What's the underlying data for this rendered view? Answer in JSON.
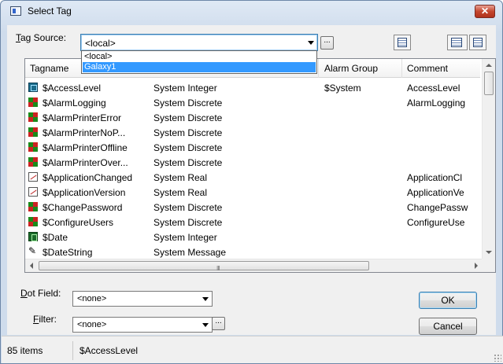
{
  "window": {
    "title": "Select Tag",
    "close_label": "✕"
  },
  "tag_source": {
    "label_accel": "T",
    "label_rest": "ag Source:",
    "value": "<local>",
    "browse_label": "...",
    "options": [
      "<local>",
      "Galaxy1"
    ],
    "highlighted_option": "Galaxy1"
  },
  "grid": {
    "columns": [
      "Tagname",
      "Alarm Group",
      "Comment"
    ],
    "rows": [
      {
        "icon": "integer-tag-icon",
        "tagname": "$AccessLevel",
        "type": "System Integer",
        "alarm_group": "$System",
        "comment": "AccessLevel"
      },
      {
        "icon": "discrete-tag-icon",
        "tagname": "$AlarmLogging",
        "type": "System Discrete",
        "alarm_group": "",
        "comment": "AlarmLogging"
      },
      {
        "icon": "discrete-tag-icon",
        "tagname": "$AlarmPrinterError",
        "type": "System Discrete",
        "alarm_group": "",
        "comment": ""
      },
      {
        "icon": "discrete-tag-icon",
        "tagname": "$AlarmPrinterNoP...",
        "type": "System Discrete",
        "alarm_group": "",
        "comment": ""
      },
      {
        "icon": "discrete-tag-icon",
        "tagname": "$AlarmPrinterOffline",
        "type": "System Discrete",
        "alarm_group": "",
        "comment": ""
      },
      {
        "icon": "discrete-tag-icon",
        "tagname": "$AlarmPrinterOver...",
        "type": "System Discrete",
        "alarm_group": "",
        "comment": ""
      },
      {
        "icon": "real-tag-icon",
        "tagname": "$ApplicationChanged",
        "type": "System Real",
        "alarm_group": "",
        "comment": "ApplicationCl"
      },
      {
        "icon": "real-tag-icon",
        "tagname": "$ApplicationVersion",
        "type": "System Real",
        "alarm_group": "",
        "comment": "ApplicationVe"
      },
      {
        "icon": "discrete-tag-icon",
        "tagname": "$ChangePassword",
        "type": "System Discrete",
        "alarm_group": "",
        "comment": "ChangePassw"
      },
      {
        "icon": "discrete-tag-icon",
        "tagname": "$ConfigureUsers",
        "type": "System Discrete",
        "alarm_group": "",
        "comment": "ConfigureUse"
      },
      {
        "icon": "date-tag-icon",
        "tagname": "$Date",
        "type": "System Integer",
        "alarm_group": "",
        "comment": ""
      },
      {
        "icon": "message-tag-icon",
        "tagname": "$DateString",
        "type": "System Message",
        "alarm_group": "",
        "comment": ""
      }
    ],
    "hscroll_grip": "III"
  },
  "dot_field": {
    "label_accel": "D",
    "label_rest": "ot Field:",
    "value": "<none>"
  },
  "filter": {
    "label_accel": "F",
    "label_rest": "ilter:",
    "value": "<none>",
    "browse_label": "..."
  },
  "buttons": {
    "ok": "OK",
    "cancel": "Cancel"
  },
  "status": {
    "count": "85 items",
    "selected": "$AccessLevel"
  },
  "colors": {
    "selection": "#3399ff",
    "dialog_bg": "#f0f0f0",
    "title_gradient": "#dfe9f5"
  }
}
